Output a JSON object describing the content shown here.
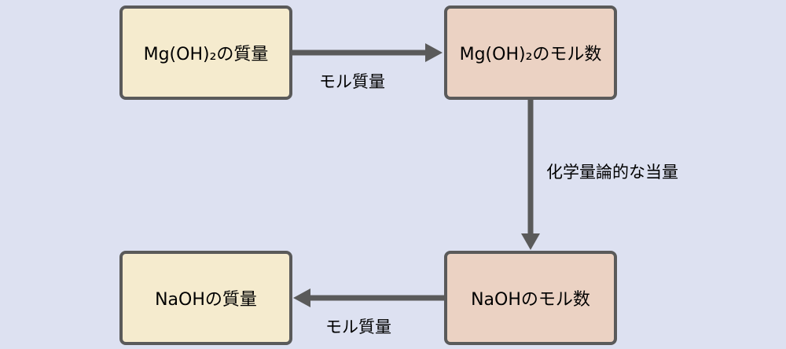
{
  "nodes": {
    "mg_mass": "Mg(OH)₂の質量",
    "mg_moles": "Mg(OH)₂のモル数",
    "na_moles": "NaOHのモル数",
    "na_mass": "NaOHの質量"
  },
  "edges": {
    "top_label": "モル質量",
    "right_label": "化学量論的な当量",
    "bottom_label": "モル質量"
  },
  "colors": {
    "background": "#dde1f1",
    "mass_box_fill": "#f5ebce",
    "mole_box_fill": "#ebd2c3",
    "border": "#5a5a5a",
    "arrow": "#5a5a5a"
  }
}
